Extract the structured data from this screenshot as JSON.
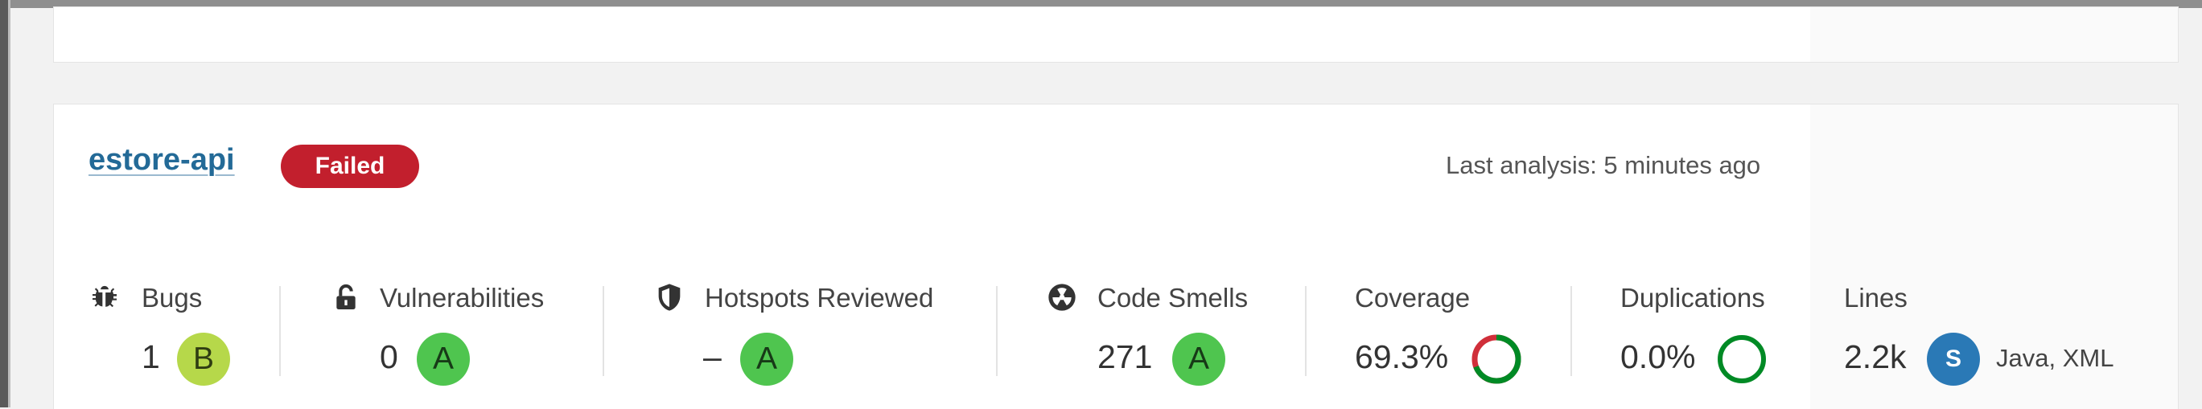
{
  "project": {
    "name": "estore-api",
    "quality_gate": "Failed",
    "last_analysis": "Last analysis: 5 minutes ago"
  },
  "metrics": {
    "bugs": {
      "label": "Bugs",
      "value": "1",
      "rating": "B",
      "icon": "bug-icon"
    },
    "vulnerabilities": {
      "label": "Vulnerabilities",
      "value": "0",
      "rating": "A",
      "icon": "lock-icon"
    },
    "hotspots": {
      "label": "Hotspots Reviewed",
      "value": "–",
      "rating": "A",
      "icon": "shield-icon"
    },
    "code_smells": {
      "label": "Code Smells",
      "value": "271",
      "rating": "A",
      "icon": "radiation-icon"
    },
    "coverage": {
      "label": "Coverage",
      "value": "69.3%",
      "fraction": 0.693
    },
    "duplications": {
      "label": "Duplications",
      "value": "0.0%",
      "fraction": 0.0
    },
    "lines": {
      "label": "Lines",
      "value": "2.2k",
      "size": "S",
      "languages": "Java, XML"
    }
  },
  "colors": {
    "link": "#236a97",
    "failed": "#c21f2d",
    "rating_a": "#4fc54f",
    "rating_b": "#b6d84a",
    "coverage_good": "#008a25",
    "coverage_bad": "#d02f3a",
    "size_badge": "#2a79b6"
  }
}
